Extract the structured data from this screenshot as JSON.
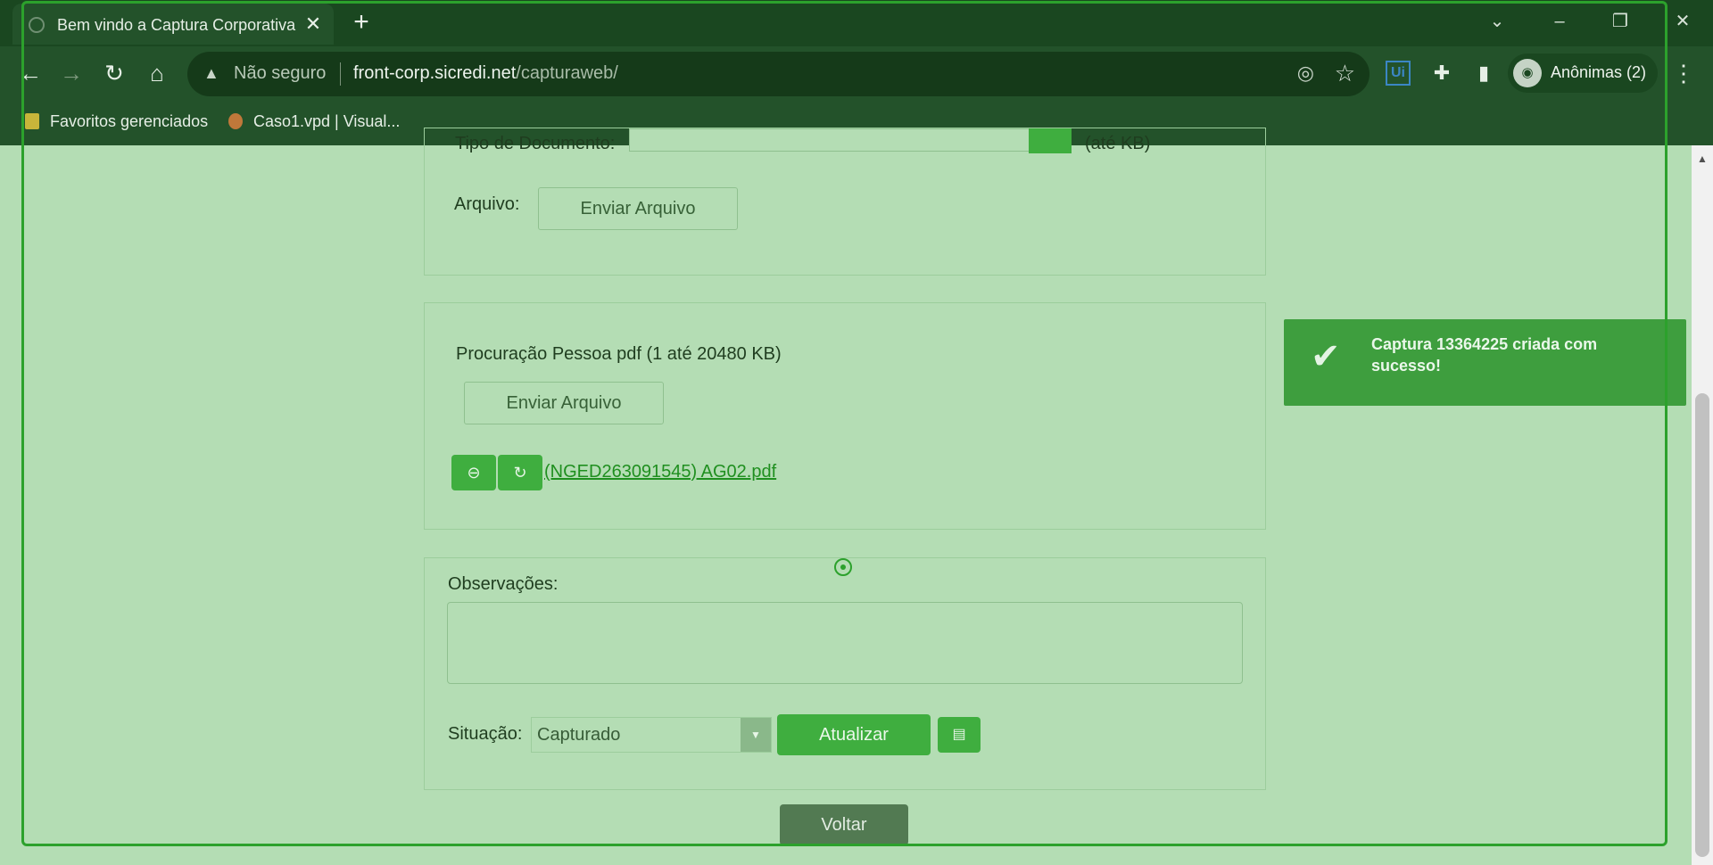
{
  "browser": {
    "tab_title": "Bem vindo a Captura Corporativa",
    "security_label": "Não seguro",
    "url_host": "front-corp.sicredi.net",
    "url_path": "/capturaweb/",
    "profile_label": "Anônimas (2)",
    "bookmarks": [
      "Favoritos gerenciados",
      "Caso1.vpd | Visual..."
    ]
  },
  "form": {
    "doc_type_label": "Tipo de Documento:",
    "doc_type_hint": "(até KB)",
    "file_label": "Arquivo:",
    "send_file_label": "Enviar Arquivo",
    "procuracao_title": "Procuração Pessoa pdf (1 até 20480 KB)",
    "procuracao_send_label": "Enviar Arquivo",
    "attached_file": "(NGED263091545) AG02.pdf",
    "observacoes_label": "Observações:",
    "observacoes_value": "",
    "situacao_label": "Situação:",
    "situacao_value": "Capturado",
    "update_label": "Atualizar",
    "back_label": "Voltar"
  },
  "toast": {
    "message": "Captura 13364225 criada com sucesso!"
  },
  "colors": {
    "overlay": "#b4ddb4",
    "accent": "#3fae3f",
    "chrome": "#1a4720"
  }
}
